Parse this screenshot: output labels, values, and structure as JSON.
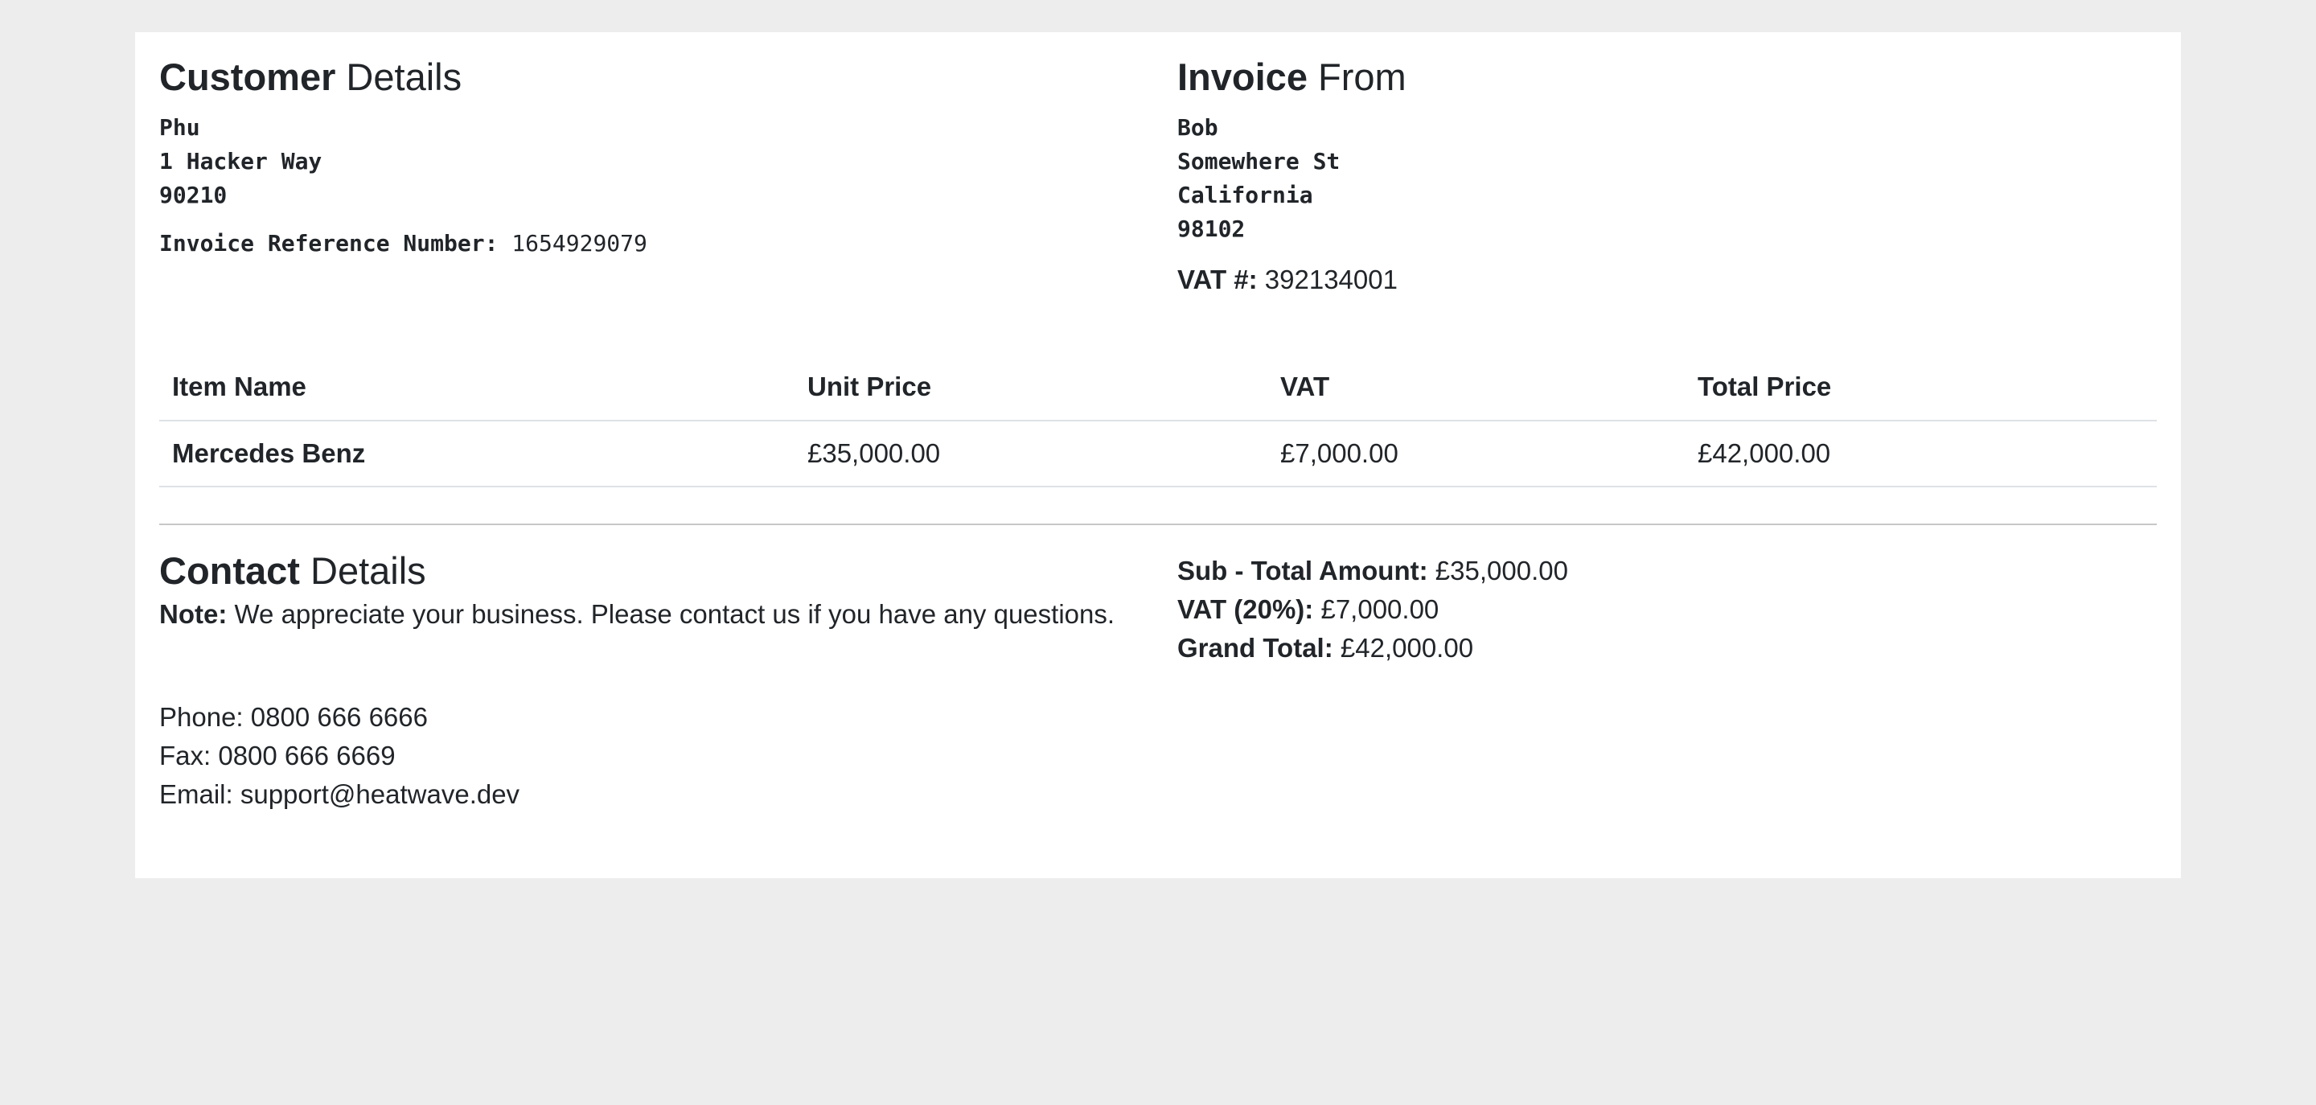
{
  "customer": {
    "title_bold": "Customer",
    "title_rest": " Details",
    "name": "Phu",
    "address_line": "1 Hacker Way",
    "postcode": "90210",
    "reference_label": "Invoice Reference Number:",
    "reference_value": " 1654929079"
  },
  "invoice_from": {
    "title_bold": "Invoice",
    "title_rest": " From",
    "name": "Bob",
    "street": "Somewhere St",
    "state": "California",
    "postcode": "98102",
    "vat_label": "VAT #:",
    "vat_value": " 392134001"
  },
  "table": {
    "headers": [
      "Item Name",
      "Unit Price",
      "VAT",
      "Total Price"
    ],
    "rows": [
      {
        "item": "Mercedes Benz",
        "unit_price": "£35,000.00",
        "vat": "£7,000.00",
        "total": "£42,000.00"
      }
    ]
  },
  "contact": {
    "title_bold": "Contact",
    "title_rest": " Details",
    "note_label": "Note:",
    "note_text": " We appreciate your business. Please contact us if you have any questions.",
    "phone": "Phone: 0800 666 6666",
    "fax": "Fax: 0800 666 6669",
    "email": "Email: support@heatwave.dev"
  },
  "totals": {
    "subtotal_label": "Sub - Total Amount:",
    "subtotal_value": " £35,000.00",
    "vat_label": "VAT (20%):",
    "vat_value": " £7,000.00",
    "grand_label": "Grand Total:",
    "grand_value": " £42,000.00"
  }
}
